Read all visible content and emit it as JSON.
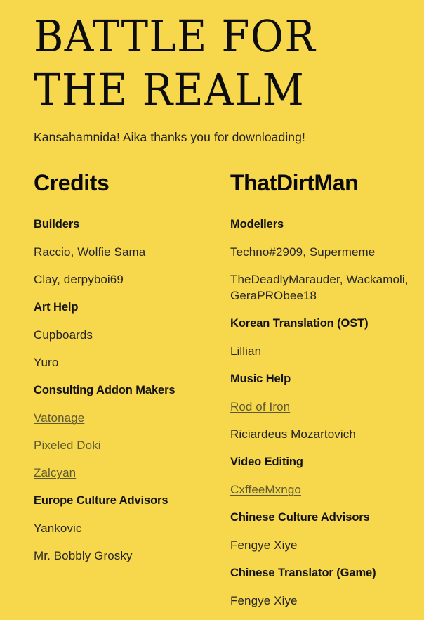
{
  "theme": {
    "background": "#f7d74c",
    "text": "#262621",
    "heading": "#0d0d0d",
    "link": "#5d5a32"
  },
  "masthead": {
    "title_line_1": "BATTLE FOR",
    "title_line_2": "THE REALM",
    "subtitle": "Kansahamnida! Aika thanks you for downloading!"
  },
  "columns": [
    {
      "title": "Credits",
      "entries": [
        {
          "role": "Builders",
          "names": [
            {
              "text": "Raccio, Wolfie Sama",
              "link": false
            },
            {
              "text": "Clay, derpyboi69",
              "link": false
            }
          ]
        },
        {
          "role": "Art Help",
          "names": [
            {
              "text": "Cupboards",
              "link": false
            },
            {
              "text": "Yuro",
              "link": false
            }
          ]
        },
        {
          "role": "Consulting Addon Makers",
          "names": [
            {
              "text": "Vatonage",
              "link": true
            },
            {
              "text": "Pixeled Doki",
              "link": true
            },
            {
              "text": "Zalcyan",
              "link": true
            }
          ]
        },
        {
          "role": "Europe Culture Advisors",
          "names": [
            {
              "text": "Yankovic",
              "link": false
            },
            {
              "text": "Mr. Bobbly Grosky",
              "link": false
            }
          ]
        }
      ]
    },
    {
      "title": "ThatDirtMan",
      "entries": [
        {
          "role": "Modellers",
          "names": [
            {
              "text": "Techno#2909, Supermeme",
              "link": false
            },
            {
              "text": "TheDeadlyMarauder, Wackamoli, GeraPRObee18",
              "link": false,
              "tight": true
            }
          ]
        },
        {
          "role": "Korean Translation (OST)",
          "names": [
            {
              "text": "Lillian",
              "link": false
            }
          ]
        },
        {
          "role": "Music Help",
          "names": [
            {
              "text": "Rod of Iron",
              "link": true
            },
            {
              "text": "Riciardeus Mozartovich",
              "link": false
            }
          ]
        },
        {
          "role": "Video Editing",
          "names": [
            {
              "text": "CxffeeMxngo",
              "link": true
            }
          ]
        },
        {
          "role": "Chinese Culture Advisors",
          "names": [
            {
              "text": "Fengye Xiye",
              "link": false
            }
          ]
        },
        {
          "role": "Chinese Translator (Game)",
          "names": [
            {
              "text": "Fengye Xiye",
              "link": false
            }
          ]
        }
      ]
    }
  ]
}
